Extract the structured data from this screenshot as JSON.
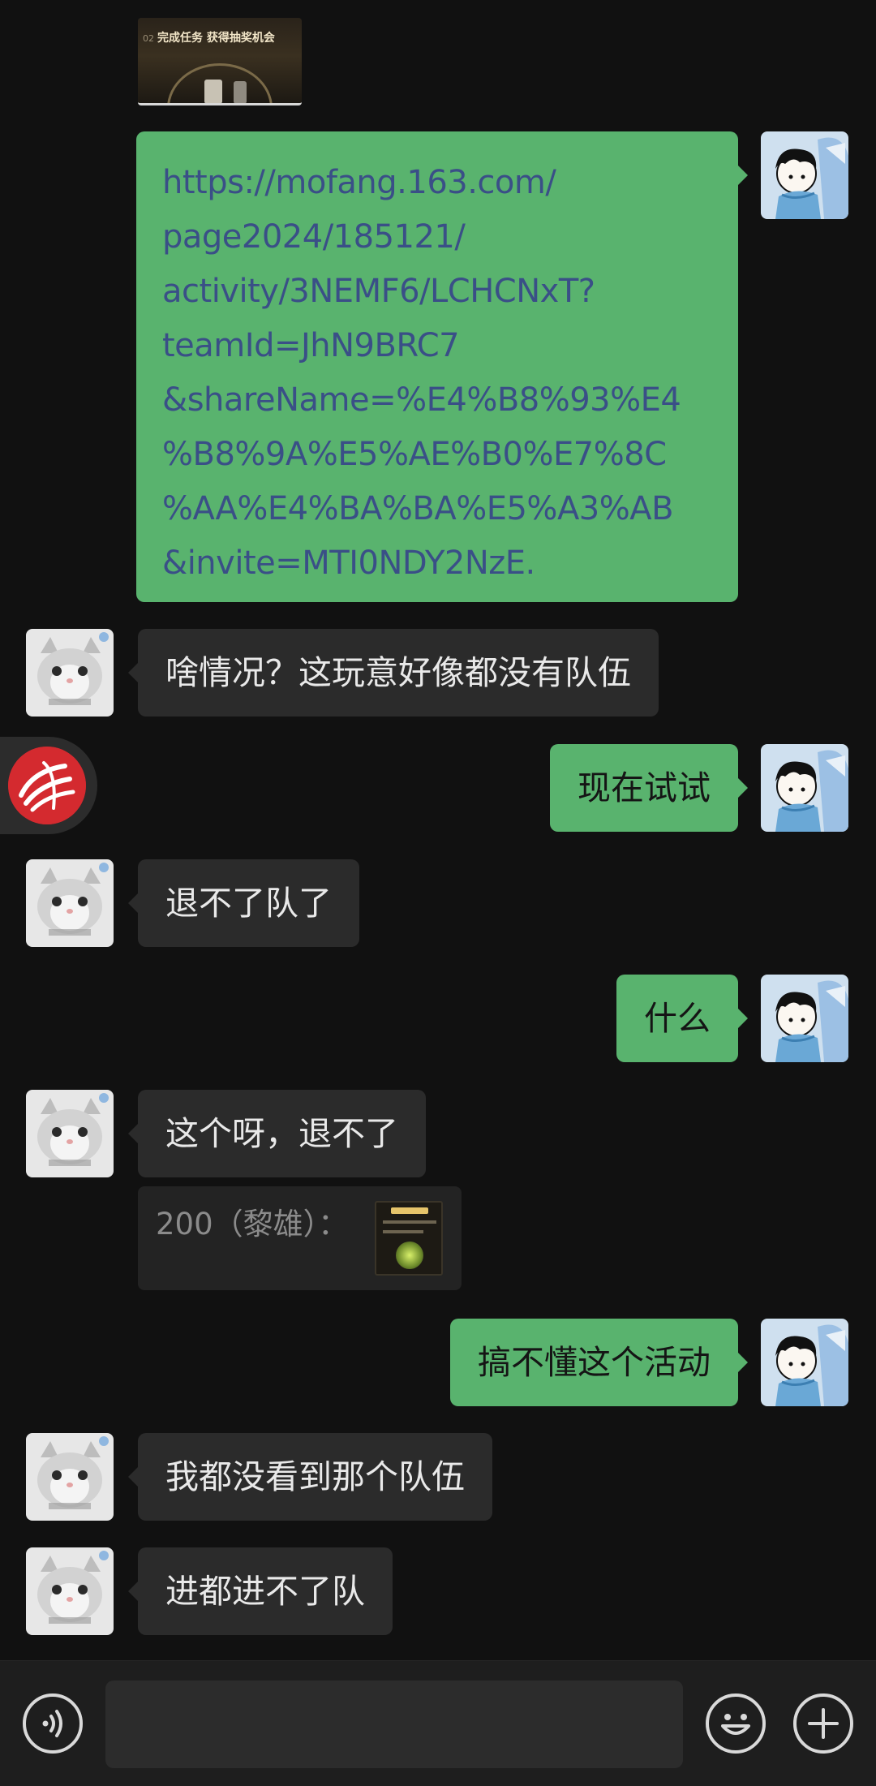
{
  "chat": {
    "shared_link": {
      "thumbnail_number": "02",
      "thumbnail_caption": "完成任务 获得抽奖机会",
      "lines": [
        "https://mofang.163.com/",
        "page2024/185121/",
        "activity/3NEMF6/LCHCNxT?",
        "teamId=JhN9BRC7",
        "&shareName=%E4%B8%93%E4",
        "%B8%9A%E5%AE%B0%E7%8C",
        "%AA%E4%BA%BA%E5%A3%AB",
        "&invite=MTI0NDY2NzE."
      ]
    },
    "messages": [
      {
        "side": "left",
        "text": "啥情况？这玩意好像都没有队伍"
      },
      {
        "side": "right",
        "text": "现在试试"
      },
      {
        "side": "left",
        "text": "退不了队了"
      },
      {
        "side": "right",
        "text": "什么"
      },
      {
        "side": "left",
        "text": "这个呀，退不了"
      },
      {
        "side": "right",
        "text": "搞不懂这个活动"
      },
      {
        "side": "left",
        "text": "我都没看到那个队伍"
      },
      {
        "side": "left",
        "text": "进都进不了队"
      }
    ],
    "quote": {
      "text": "200（黎雄）："
    }
  },
  "input_bar": {
    "voice_icon": "voice-icon",
    "emoji_icon": "emoji-icon",
    "plus_icon": "plus-icon",
    "placeholder": ""
  },
  "colors": {
    "background": "#111111",
    "bubble_left": "#2b2b2b",
    "bubble_right": "#59b36e",
    "link_text": "#3a4f87"
  }
}
